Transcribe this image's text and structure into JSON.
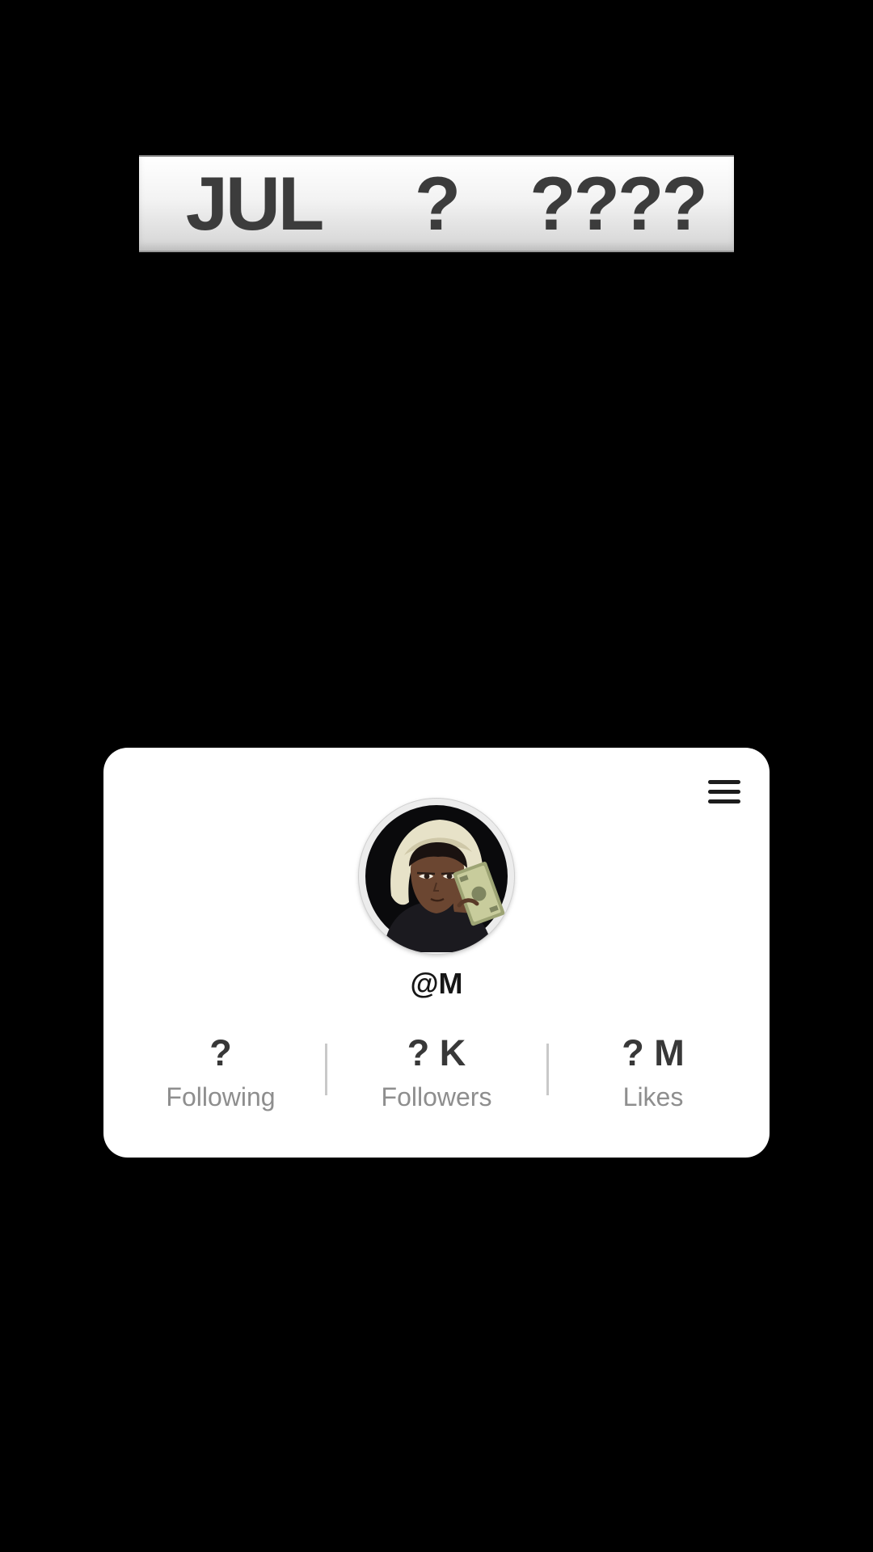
{
  "date_banner": {
    "month": "JUL",
    "day": "?",
    "year": "????"
  },
  "profile": {
    "username": "@M",
    "avatar_icon": "avatar-hooded-character-with-cash",
    "menu_icon": "hamburger-menu-icon",
    "stats": [
      {
        "value": "?",
        "label": "Following"
      },
      {
        "value": "? K",
        "label": "Followers"
      },
      {
        "value": "? M",
        "label": "Likes"
      }
    ]
  },
  "colors": {
    "background": "#000000",
    "card": "#ffffff",
    "stat_value": "#383838",
    "stat_label": "#8e8e8e",
    "banner_text": "#3c3c3c"
  }
}
